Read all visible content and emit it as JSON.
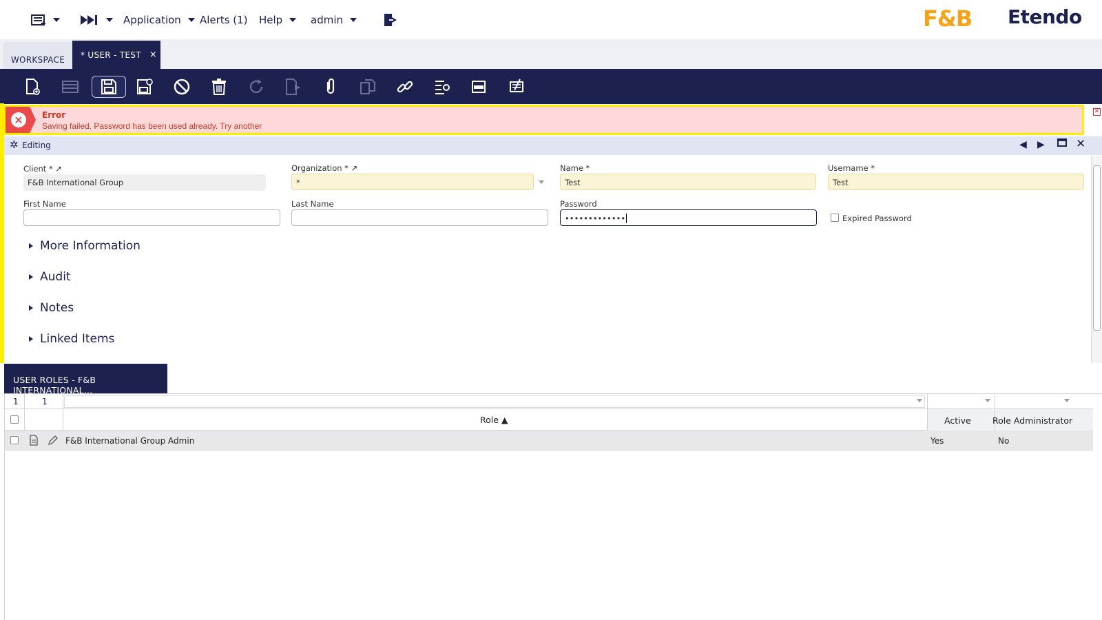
{
  "topbar": {
    "application": "Application",
    "alerts": "Alerts (1)",
    "help": "Help",
    "user": "admin",
    "logo_fb": "F&B",
    "logo_etendo": "Etendo"
  },
  "tabs": {
    "workspace": "WORKSPACE",
    "active": "* USER - TEST",
    "close": "×"
  },
  "error": {
    "title": "Error",
    "message": "Saving failed. Password has been used already. Try another"
  },
  "editing": {
    "label": "Editing"
  },
  "form": {
    "client_label": "Client *",
    "client_value": "F&B International Group",
    "organization_label": "Organization *",
    "organization_value": "*",
    "name_label": "Name *",
    "name_value": "Test",
    "username_label": "Username *",
    "username_value": "Test",
    "first_name_label": "First Name",
    "last_name_label": "Last Name",
    "password_label": "Password",
    "password_value": "•••••••••••••",
    "expired_password_label": "Expired Password"
  },
  "sections": [
    "More Information",
    "Audit",
    "Notes",
    "Linked Items"
  ],
  "grid": {
    "tab_label": "USER ROLES - F&B INTERNATIONAL...",
    "filter_count_1": "1",
    "filter_count_2": "1",
    "col_role": "Role ▲",
    "col_active": "Active",
    "col_role_admin": "Role Administrator",
    "rows": [
      {
        "role": "F&B International Group Admin",
        "active": "Yes",
        "role_admin": "No"
      }
    ]
  },
  "colors": {
    "navy": "#1c2150",
    "error_bg": "#ffd9d9",
    "highlight": "#ffee00",
    "required_bg": "#fbf5d5",
    "fb_orange": "#f5a21b"
  }
}
